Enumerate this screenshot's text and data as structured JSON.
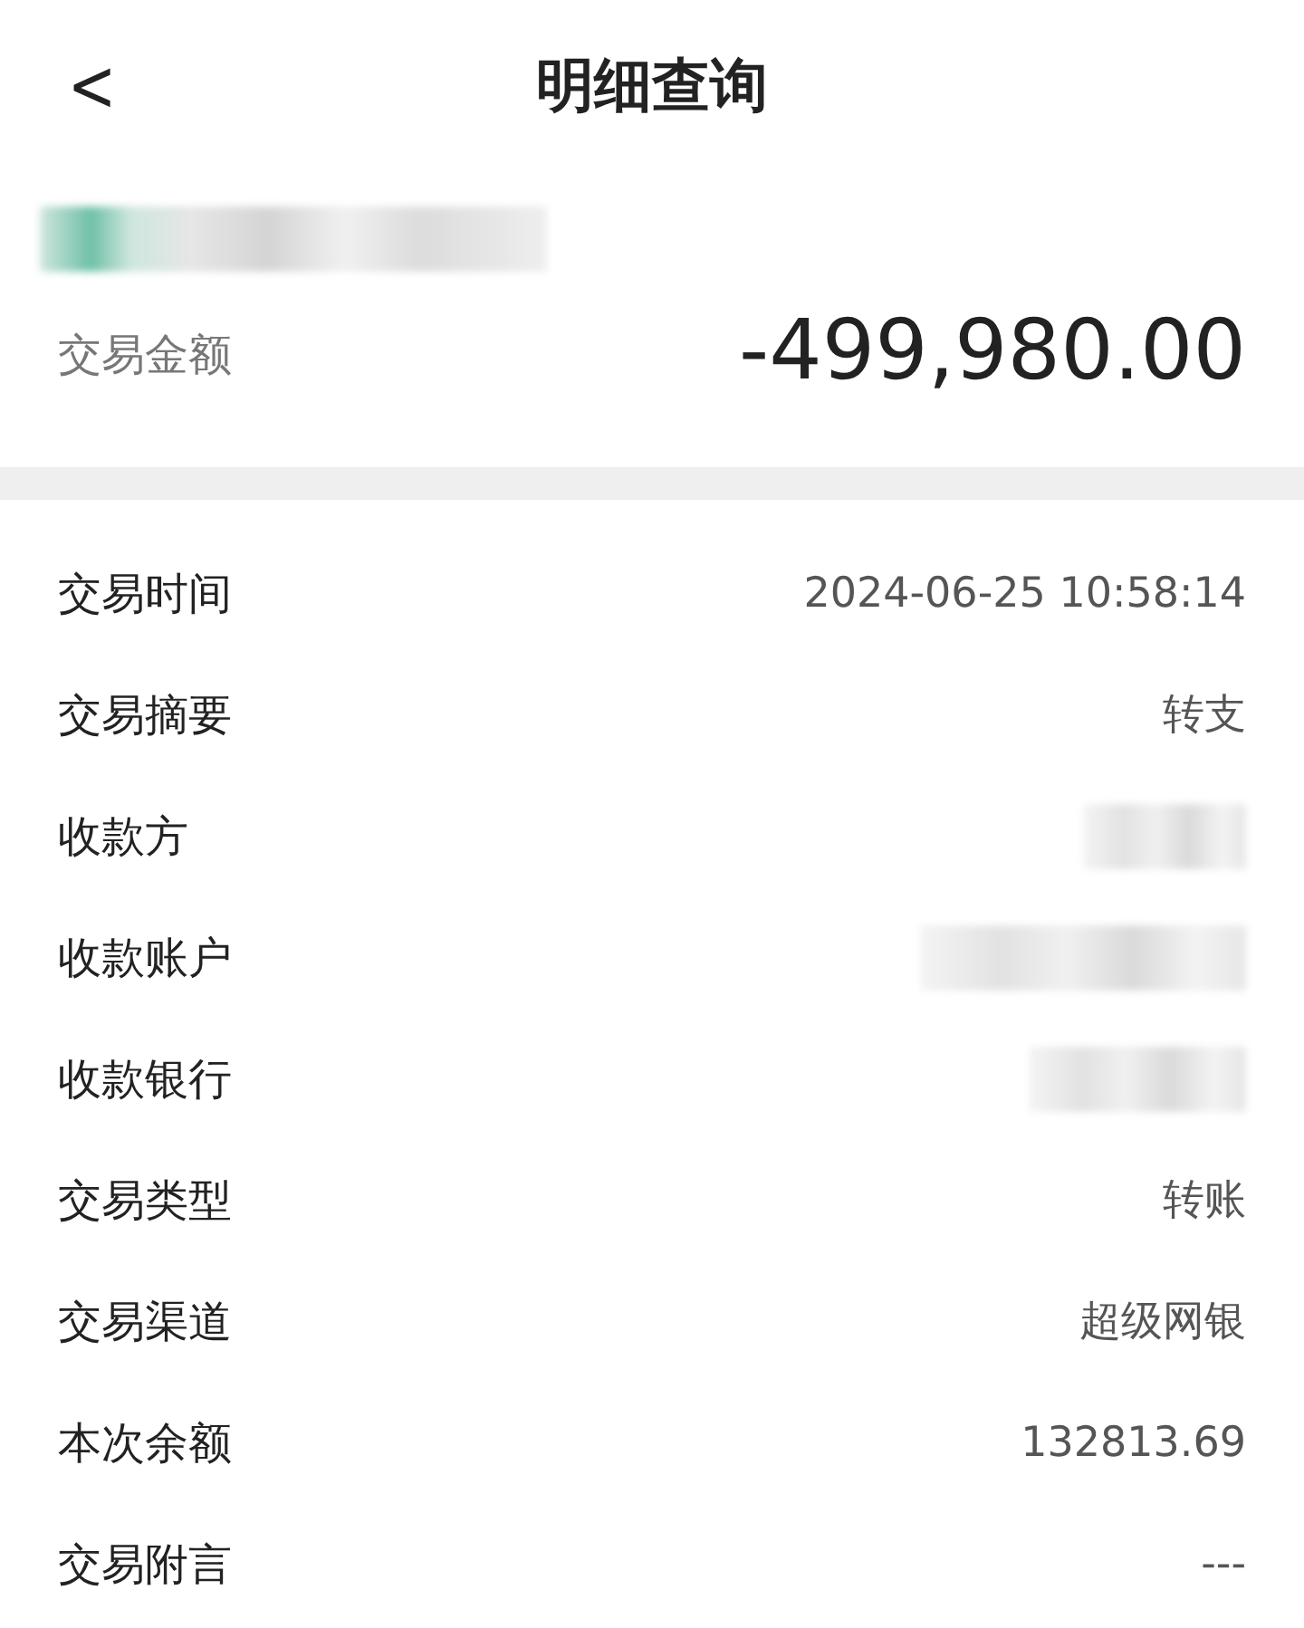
{
  "header": {
    "back": "<",
    "title": "明细查询"
  },
  "account": {
    "kind": "redacted"
  },
  "amount": {
    "label": "交易金额",
    "value": "-499,980.00"
  },
  "details": [
    {
      "label": "交易时间",
      "kind": "text",
      "value": "2024-06-25 10:58:14"
    },
    {
      "label": "交易摘要",
      "kind": "text",
      "value": "转支"
    },
    {
      "label": "收款方",
      "kind": "redacted"
    },
    {
      "label": "收款账户",
      "kind": "redacted"
    },
    {
      "label": "收款银行",
      "kind": "redacted"
    },
    {
      "label": "交易类型",
      "kind": "text",
      "value": "转账"
    },
    {
      "label": "交易渠道",
      "kind": "text",
      "value": "超级网银"
    },
    {
      "label": "本次余额",
      "kind": "text",
      "value": "132813.69"
    },
    {
      "label": "交易附言",
      "kind": "text",
      "value": "---"
    }
  ]
}
